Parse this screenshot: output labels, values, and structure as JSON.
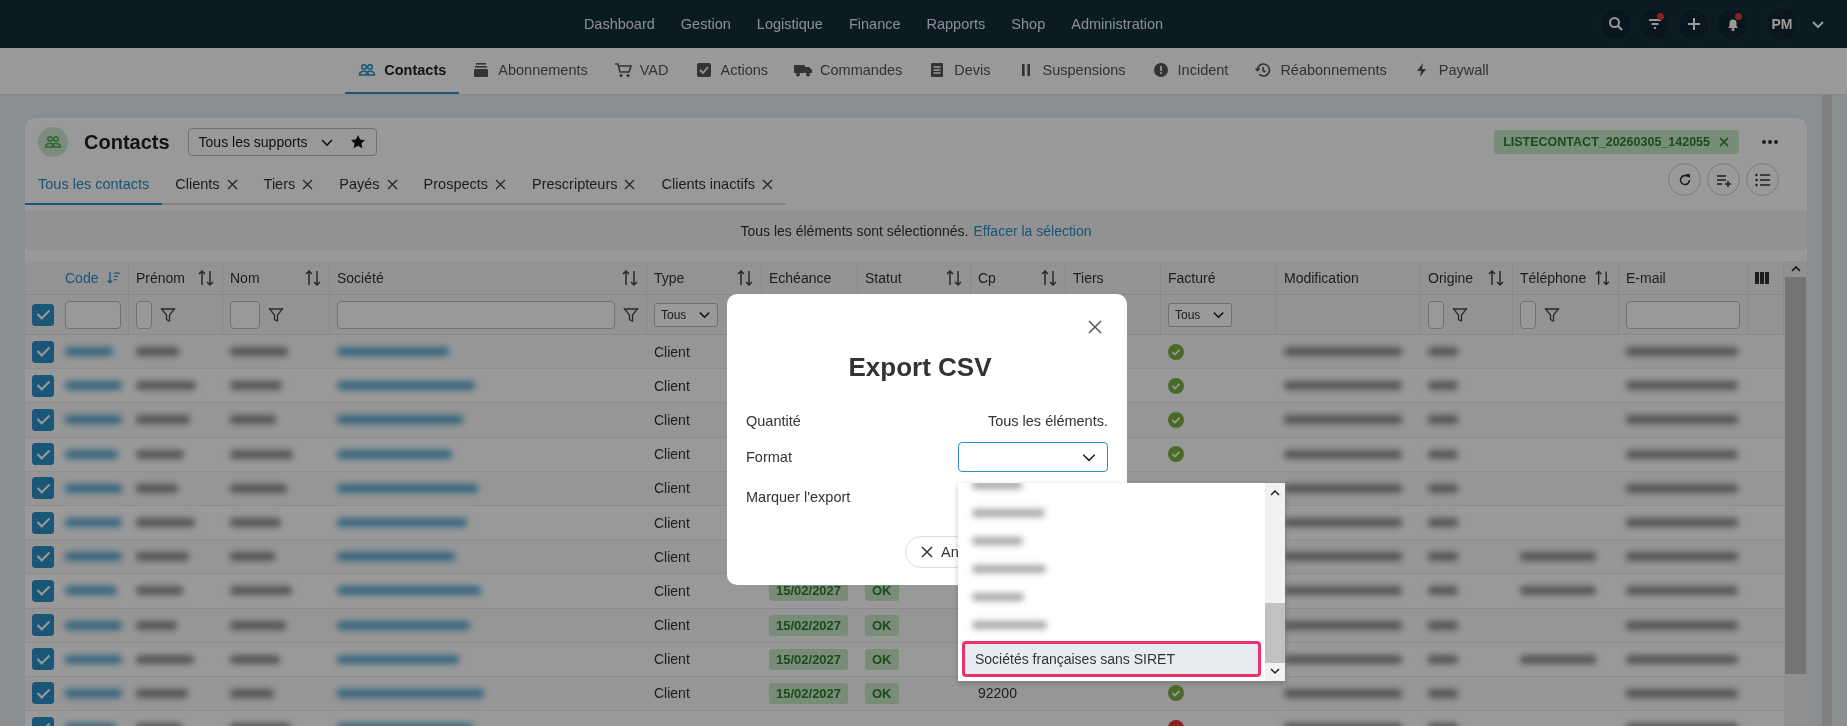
{
  "top_nav": {
    "items": [
      {
        "label": "Dashboard"
      },
      {
        "label": "Gestion"
      },
      {
        "label": "Logistique"
      },
      {
        "label": "Finance"
      },
      {
        "label": "Rapports"
      },
      {
        "label": "Shop"
      },
      {
        "label": "Administration"
      }
    ],
    "actions": [
      {
        "kind": "search",
        "badge": false
      },
      {
        "kind": "filter",
        "badge": true
      },
      {
        "kind": "add",
        "badge": false
      },
      {
        "kind": "bell",
        "badge": true
      }
    ],
    "avatar": "PM"
  },
  "sub_nav": [
    {
      "label": "Contacts",
      "kind": "people",
      "selected": true
    },
    {
      "label": "Abonnements",
      "kind": "subscriptions",
      "selected": false
    },
    {
      "label": "VAD",
      "kind": "cart",
      "selected": false
    },
    {
      "label": "Actions",
      "kind": "check",
      "selected": false
    },
    {
      "label": "Commandes",
      "kind": "truck",
      "selected": false
    },
    {
      "label": "Devis",
      "kind": "document",
      "selected": false
    },
    {
      "label": "Suspensions",
      "kind": "pause",
      "selected": false
    },
    {
      "label": "Incident",
      "kind": "alert",
      "selected": false
    },
    {
      "label": "Réabonnements",
      "kind": "history",
      "selected": false
    },
    {
      "label": "Paywall",
      "kind": "bolt",
      "selected": false
    }
  ],
  "page": {
    "title": "Contacts",
    "support_select": "Tous les supports",
    "export_tag": "LISTECONTACT_20260305_142055"
  },
  "tabs": [
    {
      "label": "Tous les contacts",
      "selected": true,
      "closable": false
    },
    {
      "label": "Clients",
      "selected": false,
      "closable": true
    },
    {
      "label": "Tiers",
      "selected": false,
      "closable": true
    },
    {
      "label": "Payés",
      "selected": false,
      "closable": true
    },
    {
      "label": "Prospects",
      "selected": false,
      "closable": true
    },
    {
      "label": "Prescripteurs",
      "selected": false,
      "closable": true
    },
    {
      "label": "Clients inactifs",
      "selected": false,
      "closable": true
    }
  ],
  "selection_banner": {
    "text": "Tous les éléments sont sélectionnés.",
    "link": "Effacer la sélection"
  },
  "table": {
    "all_selected": true,
    "columns": [
      {
        "label": "Code",
        "sortable": true,
        "sorted": true,
        "filter": {
          "kind": "input"
        }
      },
      {
        "label": "Prénom",
        "sortable": true,
        "sorted": false,
        "filter": {
          "kind": "input-funnel"
        }
      },
      {
        "label": "Nom",
        "sortable": true,
        "sorted": false,
        "filter": {
          "kind": "input-funnel"
        }
      },
      {
        "label": "Société",
        "sortable": true,
        "sorted": false,
        "filter": {
          "kind": "input-funnel"
        }
      },
      {
        "label": "Type",
        "sortable": true,
        "sorted": false,
        "filter": {
          "kind": "select",
          "value": "Tous"
        }
      },
      {
        "label": "Echéance",
        "sortable": false,
        "sorted": false
      },
      {
        "label": "Statut",
        "sortable": true,
        "sorted": false
      },
      {
        "label": "Cp",
        "sortable": true,
        "sorted": false
      },
      {
        "label": "Tiers",
        "sortable": false,
        "sorted": false
      },
      {
        "label": "Facturé",
        "sortable": false,
        "sorted": false,
        "filter": {
          "kind": "select",
          "value": "Tous"
        }
      },
      {
        "label": "Modification",
        "sortable": false,
        "sorted": false
      },
      {
        "label": "Origine",
        "sortable": true,
        "sorted": false,
        "filter": {
          "kind": "input-funnel"
        }
      },
      {
        "label": "Téléphone",
        "sortable": true,
        "sorted": false,
        "filter": {
          "kind": "input-funnel"
        }
      },
      {
        "label": "E-mail",
        "sortable": false,
        "sorted": false,
        "filter": {
          "kind": "input"
        }
      }
    ],
    "rows": [
      {
        "selected": true,
        "type": "Client",
        "invoiced": true,
        "has_phone": false
      },
      {
        "selected": true,
        "type": "Client",
        "invoiced": true,
        "has_phone": false
      },
      {
        "selected": true,
        "type": "Client",
        "invoiced": true,
        "has_phone": false
      },
      {
        "selected": true,
        "type": "Client",
        "invoiced": true,
        "has_phone": false
      },
      {
        "selected": true,
        "type": "Client",
        "has_phone": false
      },
      {
        "selected": true,
        "type": "Client",
        "has_phone": false
      },
      {
        "selected": true,
        "type": "Client",
        "has_phone": true
      },
      {
        "selected": true,
        "type": "Client",
        "echeance": "15/02/2027",
        "statut": "OK",
        "has_phone": true
      },
      {
        "selected": true,
        "type": "Client",
        "echeance": "15/02/2027",
        "statut": "OK",
        "has_phone": false
      },
      {
        "selected": true,
        "type": "Client",
        "echeance": "15/02/2027",
        "statut": "OK",
        "has_phone": true
      },
      {
        "selected": true,
        "type": "Client",
        "echeance": "15/02/2027",
        "statut": "OK",
        "cp": "92200",
        "invoiced": true,
        "has_phone": false
      },
      {
        "selected": true,
        "invoiced": false,
        "has_phone": false
      }
    ]
  },
  "modal": {
    "title": "Export CSV",
    "fields": [
      {
        "label": "Quantité",
        "kind": "text",
        "value": "Tous les éléments."
      },
      {
        "label": "Format",
        "kind": "select"
      },
      {
        "label": "Marquer l'export",
        "kind": "label"
      }
    ],
    "cancel_label": "An",
    "format_options": [
      {
        "kind": "blurred",
        "selected": false
      },
      {
        "kind": "blurred",
        "selected": false
      },
      {
        "kind": "blurred",
        "selected": false
      },
      {
        "kind": "blurred",
        "selected": false
      },
      {
        "kind": "blurred",
        "selected": false
      },
      {
        "kind": "blurred",
        "selected": false
      },
      {
        "kind": "text",
        "label": "Sociétés françaises sans SIRET",
        "selected": true
      }
    ]
  }
}
